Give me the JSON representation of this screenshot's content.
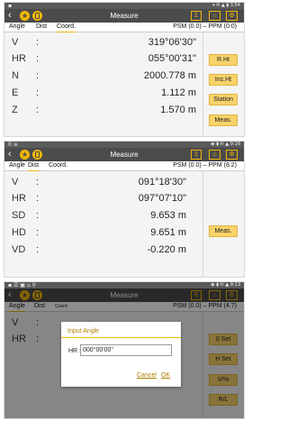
{
  "screens": [
    {
      "status_left": "▪",
      "status_right": "▾ ✉ ▲ ▮ 3:54",
      "title": "Measure",
      "toolbar_icons": [
        "1",
        "doc-icon",
        "settings-icon"
      ],
      "tabs": [
        "Angle",
        "Dist",
        "Coord."
      ],
      "active_tab": "Coord.",
      "psm": "PSM (0.0) – PPM (0.0)",
      "rows": [
        {
          "label": "V",
          "value": "319°06'30\""
        },
        {
          "label": "HR",
          "value": "055°00'31\""
        },
        {
          "label": "N",
          "value": "2000.778 m"
        },
        {
          "label": "E",
          "value": "1.112 m"
        },
        {
          "label": "Z",
          "value": "1.570 m"
        }
      ],
      "buttons": [
        "R.Ht",
        "Ins.Ht",
        "Station",
        "Meas."
      ]
    },
    {
      "status_left": "0 ≡",
      "status_right": "◉ ▮ ✉ ▲ 9:16",
      "title": "Measure",
      "toolbar_icons": [
        "1",
        "doc-icon",
        "settings-icon"
      ],
      "tabs": [
        "Angle",
        "Dist",
        "Coord."
      ],
      "active_tab": "Dist",
      "psm": "PSM (0.0) – PPM (8.2)",
      "rows": [
        {
          "label": "V",
          "value": "091°18'30\""
        },
        {
          "label": "HR",
          "value": "097°07'10\""
        },
        {
          "label": "SD",
          "value": "9.653 m"
        },
        {
          "label": "HD",
          "value": "9.651 m"
        },
        {
          "label": "VD",
          "value": "-0.220 m"
        }
      ],
      "buttons": [
        "Meas."
      ]
    },
    {
      "status_left": "▪ ☰ ▣ ⌂ ⚲",
      "status_right": "◉ ▮ ✉ ▲ 9:13",
      "title": "Measure",
      "toolbar_icons": [
        "S",
        "doc-icon",
        "settings-icon"
      ],
      "tabs": [
        "Angle",
        "Dist",
        "Coord."
      ],
      "active_tab": "Angle",
      "psm": "PSM (0.0) – PPM (4.7)",
      "rows": [
        {
          "label": "V",
          "value": ""
        },
        {
          "label": "HR",
          "value": ""
        }
      ],
      "buttons": [
        "0 Set",
        "H Set",
        "V/%",
        "R/L"
      ],
      "dialog": {
        "title": "Input Angle",
        "field_label": "HR :",
        "field_value": "000°00'00\"",
        "cancel": "Cancel",
        "ok": "OK"
      }
    }
  ],
  "colors": {
    "accent": "#f2b707",
    "titlebar": "#4b4b4b",
    "button_fill": "#f8d36b"
  }
}
